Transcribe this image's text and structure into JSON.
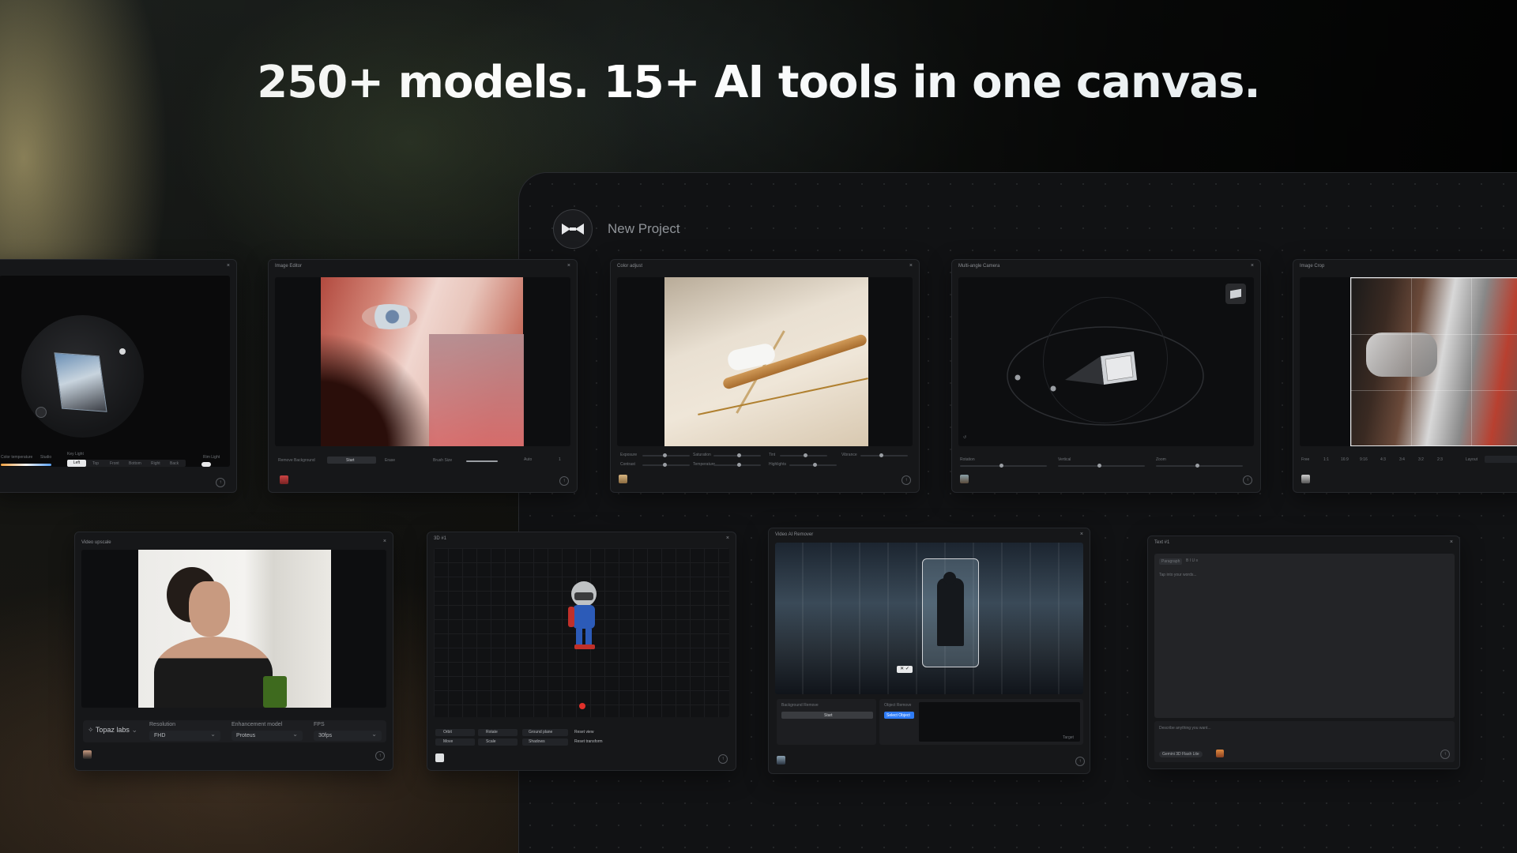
{
  "headline": "250+ models. 15+ AI tools in one canvas.",
  "project": {
    "name": "New Project",
    "logo_icon": "bowtie-logo-icon"
  },
  "cards": {
    "camera_light": {
      "close": "×",
      "labels": [
        "Color temperature",
        "Studio",
        "Key Light",
        "Rim Light"
      ],
      "tabs": [
        "Left",
        "Top",
        "Front",
        "Bottom",
        "Right",
        "Back"
      ]
    },
    "image_editor": {
      "title": "Image Editor",
      "close": "×",
      "remove_bg": "Remove Background",
      "start": "Start",
      "erase": "Erase",
      "brush_size": "Brush Size",
      "auto": "Auto",
      "count": "1"
    },
    "color_adjust": {
      "title": "Color adjust",
      "close": "×",
      "sliders": [
        "Exposure",
        "Saturation",
        "Tint",
        "Vibrance",
        "Contrast",
        "Temperature",
        "Highlights"
      ]
    },
    "multi_angle": {
      "title": "Multi-angle Camera",
      "close": "×",
      "sliders": [
        "Rotation",
        "Vertical",
        "Zoom"
      ]
    },
    "image_crop": {
      "title": "Image Crop",
      "close": "×",
      "ratios": [
        "Free",
        "1:1",
        "16:9",
        "9:16",
        "4:3",
        "3:4",
        "3:2",
        "2:3"
      ],
      "layout_label": "Layout"
    },
    "video_upscale": {
      "title": "Video upscale",
      "close": "×",
      "provider": "Topaz labs",
      "resolution_label": "Resolution",
      "resolution": "FHD",
      "enhancement_label": "Enhancement model",
      "enhancement": "Proteus",
      "fps_label": "FPS",
      "fps": "30fps"
    },
    "three_d": {
      "title": "3D #1",
      "close": "×",
      "controls": [
        "Orbit",
        "Rotate",
        "Ground plane",
        "Reset view",
        "Move",
        "Scale",
        "Shadows",
        "Reset transform"
      ]
    },
    "video_remover": {
      "title": "Video AI Remover",
      "close": "×",
      "bg_remove": "Background Remove",
      "start": "Start",
      "object_remove": "Object Remove",
      "select_object": "Select Object",
      "target": "Target"
    },
    "text": {
      "title": "Text #1",
      "close": "×",
      "format": "Paragraph",
      "placeholder": "Tap into your words...",
      "describe": "Describe anything you want...",
      "model": "Gemini 3D Flash Lite"
    }
  },
  "colors": {
    "accent_blue": "#2f7cf6",
    "record_red": "#e0302a",
    "canvas_bg": "#111214"
  }
}
